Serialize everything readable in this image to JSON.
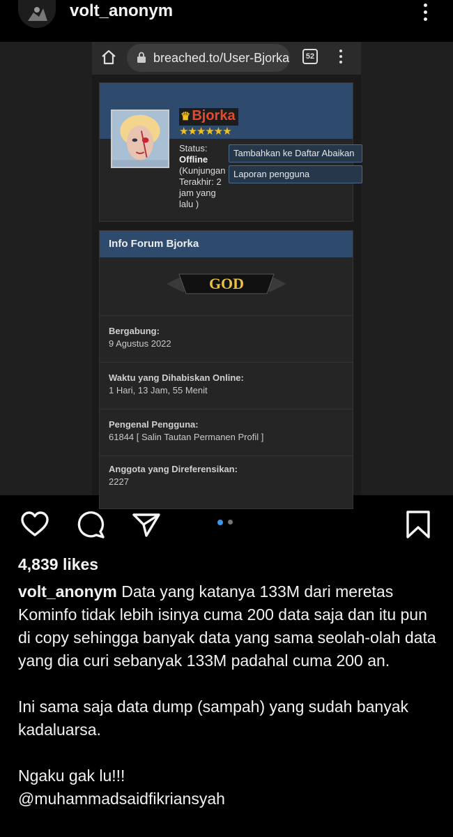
{
  "post": {
    "username": "volt_anonym",
    "likes": "4,839 likes"
  },
  "browser": {
    "url": "breached.to/User-Bjorka",
    "tab_count": "52"
  },
  "profile": {
    "name": "Bjorka",
    "stars": "★★★★★★",
    "status_label": "Status:",
    "status_value": "Offline",
    "last_visit": "(Kunjungan Terakhir: 2 jam yang lalu )",
    "ignore_button": "Tambahkan ke Daftar Abaikan",
    "report_button": "Laporan pengguna"
  },
  "forum_info": {
    "title": "Info Forum Bjorka",
    "rank": "GOD",
    "rows": [
      {
        "label": "Bergabung:",
        "value": "9 Agustus 2022"
      },
      {
        "label": "Waktu yang Dihabiskan Online:",
        "value": "1 Hari, 13 Jam, 55 Menit"
      },
      {
        "label": "Pengenal Pengguna:",
        "value": "61844 [ Salin Tautan Permanen Profil ]"
      },
      {
        "label": "Anggota yang Direferensikan:",
        "value": "2227"
      }
    ]
  },
  "caption": {
    "username": "volt_anonym",
    "paragraph1": "Data yang katanya 133M dari meretas Kominfo tidak lebih isinya cuma 200 data saja dan itu pun di copy sehingga banyak data yang sama seolah-olah data yang dia curi sebanyak 133M padahal cuma 200 an.",
    "paragraph2": "Ini sama saja data dump (sampah) yang sudah banyak kadaluarsa.",
    "paragraph3": "Ngaku gak lu!!!",
    "mention": "@muhammadsaidfikriansyah"
  },
  "carousel": {
    "active_index": 0,
    "count": 2
  },
  "colors": {
    "accent_blue": "#2e4a6c",
    "name_red": "#e24b2f",
    "star_gold": "#f0c020",
    "dot_active": "#3897f0"
  },
  "icons": [
    "home-icon",
    "lock-icon",
    "tabs-icon",
    "more-icon",
    "heart-icon",
    "comment-icon",
    "share-icon",
    "bookmark-icon",
    "crown-icon"
  ]
}
